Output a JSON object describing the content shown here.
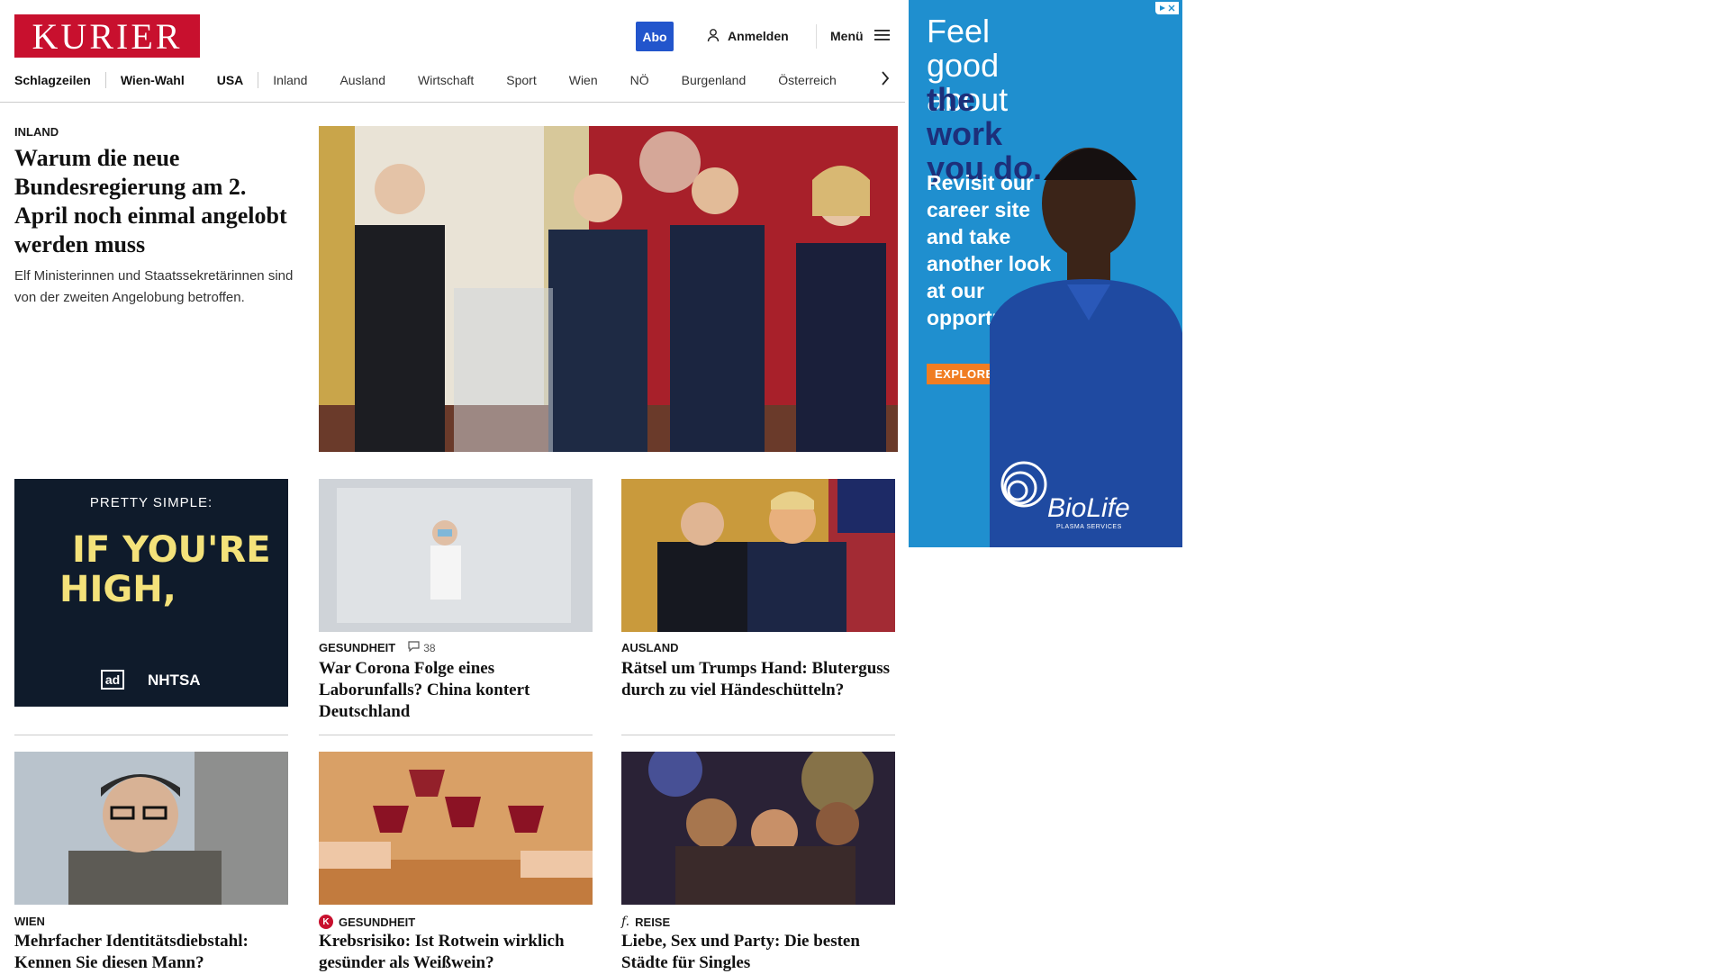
{
  "header": {
    "logo_text": "KURIER",
    "abo_label": "Abo",
    "login_label": "Anmelden",
    "menu_label": "Menü",
    "brand_color": "#c8102e",
    "abo_color": "#2255cc"
  },
  "nav": {
    "items": [
      "Schlagzeilen",
      "Wien-Wahl",
      "USA",
      "Inland",
      "Ausland",
      "Wirtschaft",
      "Sport",
      "Wien",
      "NÖ",
      "Burgenland",
      "Österreich"
    ]
  },
  "lead": {
    "kicker": "INLAND",
    "title": "Warum die neue Bundesregierung am 2. April noch einmal angelobt werden muss",
    "teaser": "Elf Ministerinnen und Staatssekretärinnen sind von der zweiten Angelobung betroffen."
  },
  "ad_small": {
    "line1": "PRETTY SIMPLE:",
    "line2": "IF YOU'RE",
    "line3": "HIGH,",
    "logo1": "ad",
    "logo2": "NHTSA"
  },
  "cards": [
    {
      "kicker": "GESUNDHEIT",
      "comments": "38",
      "title": "War Corona Folge eines Laborunfalls? China kontert Deutschland"
    },
    {
      "kicker": "AUSLAND",
      "title": "Rätsel um Trumps Hand: Bluterguss durch zu viel Händeschütteln?"
    },
    {
      "kicker": "WIEN",
      "title": "Mehrfacher Identitätsdiebstahl: Kennen Sie diesen Mann?"
    },
    {
      "kicker": "GESUNDHEIT",
      "badge": "K",
      "title": "Krebsrisiko: Ist Rotwein wirklich gesünder als Weißwein?"
    },
    {
      "kicker": "REISE",
      "badge": "f.",
      "title": "Liebe, Sex und Party: Die besten Städte für Singles"
    }
  ],
  "ad_right": {
    "line_a": "Feel good about",
    "line_b": "the work you do.",
    "line_c": "Revisit our career site and take another look at our opportunities.",
    "cta": "EXPLORE MORE",
    "brand": "BioLife",
    "brand_sub": "PLASMA SERVICES",
    "bg_color": "#1f8fcf"
  }
}
